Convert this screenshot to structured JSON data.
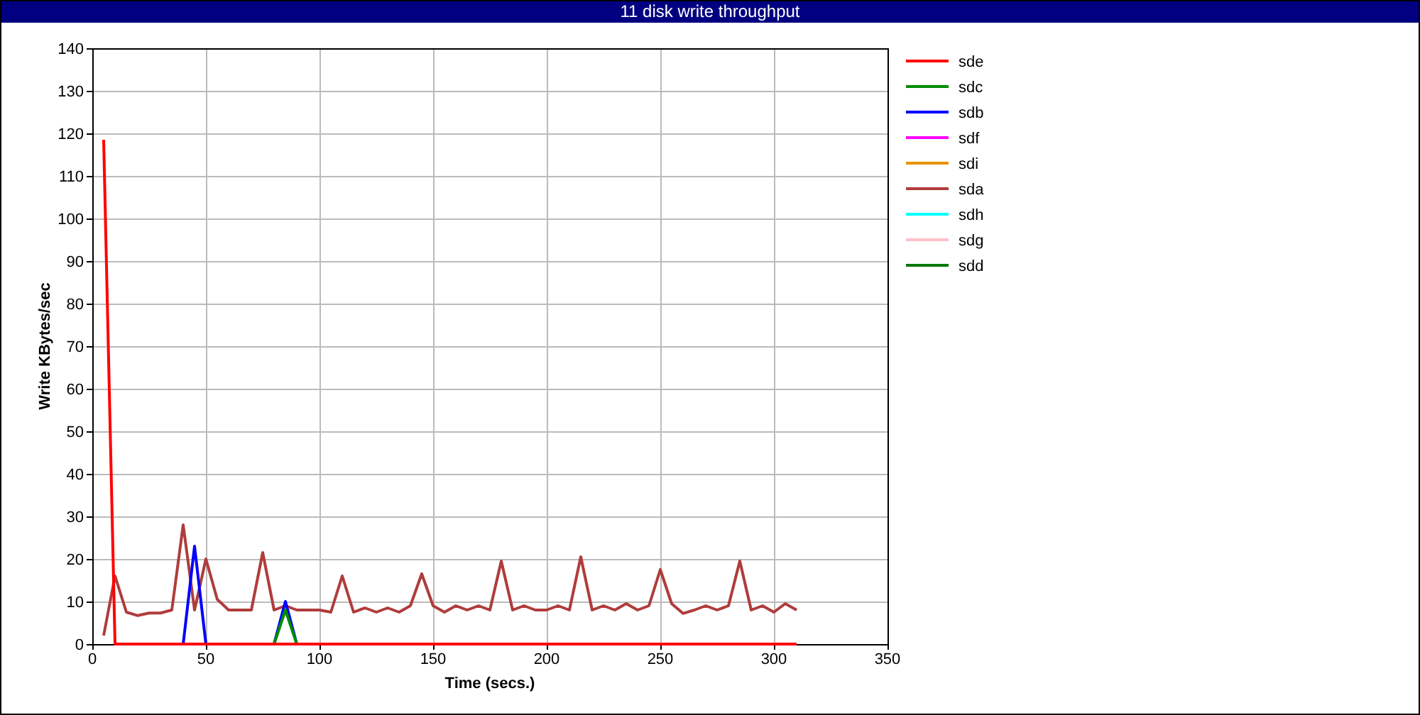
{
  "window": {
    "title": "11 disk write throughput"
  },
  "chart": {
    "chart_data": {
      "type": "line",
      "xlabel": "Time (secs.)",
      "ylabel": "Write KBytes/sec",
      "x": [
        5,
        10,
        15,
        20,
        25,
        30,
        35,
        40,
        45,
        50,
        55,
        60,
        65,
        70,
        75,
        80,
        85,
        90,
        95,
        100,
        105,
        110,
        115,
        120,
        125,
        130,
        135,
        140,
        145,
        150,
        155,
        160,
        165,
        170,
        175,
        180,
        185,
        190,
        195,
        200,
        205,
        210,
        215,
        220,
        225,
        230,
        235,
        240,
        245,
        250,
        255,
        260,
        265,
        270,
        275,
        280,
        285,
        290,
        295,
        300,
        305,
        310
      ],
      "xlim": [
        0,
        350
      ],
      "ylim": [
        0,
        140
      ],
      "xticks": [
        0,
        50,
        100,
        150,
        200,
        250,
        300,
        350
      ],
      "yticks": [
        0,
        10,
        20,
        30,
        40,
        50,
        60,
        70,
        80,
        90,
        100,
        110,
        120,
        130,
        140
      ],
      "series": [
        {
          "name": "sde",
          "color": "#ff0000",
          "values": [
            118.5,
            0,
            0,
            0,
            0,
            0,
            0,
            0,
            0,
            0,
            0,
            0,
            0,
            0,
            0,
            0,
            0,
            0,
            0,
            0,
            0,
            0,
            0,
            0,
            0,
            0,
            0,
            0,
            0,
            0,
            0,
            0,
            0,
            0,
            0,
            0,
            0,
            0,
            0,
            0,
            0,
            0,
            0,
            0,
            0,
            0,
            0,
            0,
            0,
            0,
            0,
            0,
            0,
            0,
            0,
            0,
            0,
            0,
            0,
            0,
            0,
            0
          ]
        },
        {
          "name": "sdc",
          "color": "#008c00",
          "values": [
            null,
            null,
            null,
            null,
            null,
            null,
            null,
            null,
            null,
            null,
            null,
            null,
            null,
            null,
            null,
            0,
            8,
            0,
            null,
            null,
            null,
            null,
            null,
            null,
            null,
            null,
            null,
            null,
            null,
            null,
            null,
            null,
            null,
            null,
            null,
            null,
            null,
            null,
            null,
            null,
            null,
            null,
            null,
            null,
            null,
            null,
            null,
            null,
            null,
            null,
            null,
            null,
            null,
            null,
            null,
            null,
            null,
            null,
            null,
            null,
            null,
            null
          ]
        },
        {
          "name": "sdb",
          "color": "#0000ff",
          "values": [
            null,
            null,
            null,
            null,
            null,
            null,
            null,
            0,
            23,
            0,
            null,
            null,
            null,
            null,
            null,
            0,
            10,
            0,
            null,
            null,
            null,
            null,
            null,
            null,
            null,
            null,
            null,
            null,
            null,
            null,
            null,
            null,
            null,
            null,
            null,
            null,
            null,
            null,
            null,
            null,
            null,
            null,
            null,
            null,
            null,
            null,
            null,
            null,
            null,
            null,
            null,
            null,
            null,
            null,
            null,
            null,
            null,
            null,
            null,
            null,
            null,
            null
          ]
        },
        {
          "name": "sdf",
          "color": "#ff00ff",
          "values": [
            null,
            null,
            null,
            null,
            null,
            null,
            null,
            null,
            null,
            null,
            null,
            null,
            null,
            null,
            null,
            null,
            null,
            null,
            null,
            null,
            null,
            null,
            null,
            null,
            null,
            null,
            null,
            null,
            null,
            null,
            null,
            null,
            null,
            null,
            null,
            null,
            null,
            null,
            null,
            null,
            null,
            null,
            null,
            null,
            null,
            null,
            null,
            null,
            null,
            null,
            null,
            null,
            null,
            null,
            null,
            null,
            null,
            null,
            null,
            null,
            null,
            null
          ]
        },
        {
          "name": "sdi",
          "color": "#e89400",
          "values": [
            null,
            null,
            null,
            null,
            null,
            null,
            null,
            null,
            null,
            null,
            null,
            null,
            null,
            null,
            null,
            null,
            null,
            null,
            null,
            null,
            null,
            null,
            null,
            null,
            null,
            null,
            null,
            null,
            null,
            null,
            null,
            null,
            null,
            null,
            null,
            null,
            null,
            null,
            null,
            null,
            null,
            null,
            null,
            null,
            null,
            null,
            null,
            null,
            null,
            null,
            null,
            null,
            null,
            null,
            null,
            null,
            null,
            null,
            null,
            null,
            null,
            null
          ]
        },
        {
          "name": "sda",
          "color": "#b03c3c",
          "values": [
            2,
            16,
            7.5,
            6.7,
            7.3,
            7.3,
            8,
            28,
            8,
            20,
            10.5,
            8,
            8,
            8,
            21.5,
            8,
            9,
            8,
            8,
            8,
            7.5,
            16,
            7.5,
            8.5,
            7.5,
            8.5,
            7.5,
            9,
            16.5,
            9,
            7.5,
            9,
            8,
            9,
            8,
            19.5,
            8,
            9,
            8,
            8,
            9,
            8,
            20.5,
            8,
            9,
            8,
            9.5,
            8,
            9,
            17.5,
            9.5,
            7.2,
            8,
            9,
            8,
            9,
            19.5,
            8,
            9,
            7.5,
            9.5,
            8
          ]
        },
        {
          "name": "sdh",
          "color": "#00ffff",
          "values": [
            null,
            null,
            null,
            null,
            null,
            null,
            null,
            null,
            null,
            null,
            null,
            null,
            null,
            null,
            null,
            null,
            null,
            null,
            null,
            null,
            null,
            null,
            null,
            null,
            null,
            null,
            null,
            null,
            null,
            null,
            null,
            null,
            null,
            null,
            null,
            null,
            null,
            null,
            null,
            null,
            null,
            null,
            null,
            null,
            null,
            null,
            null,
            null,
            null,
            null,
            null,
            null,
            null,
            null,
            null,
            null,
            null,
            null,
            null,
            null,
            null,
            null
          ]
        },
        {
          "name": "sdg",
          "color": "#ffc0cb",
          "values": [
            null,
            null,
            null,
            null,
            null,
            null,
            null,
            null,
            null,
            null,
            null,
            null,
            null,
            null,
            null,
            null,
            null,
            null,
            null,
            null,
            null,
            null,
            null,
            null,
            null,
            null,
            null,
            null,
            null,
            null,
            null,
            null,
            null,
            null,
            null,
            null,
            null,
            null,
            null,
            null,
            null,
            null,
            null,
            null,
            null,
            null,
            null,
            null,
            null,
            null,
            null,
            null,
            null,
            null,
            null,
            null,
            null,
            null,
            null,
            null,
            null,
            null
          ]
        },
        {
          "name": "sdd",
          "color": "#007800",
          "values": [
            null,
            null,
            null,
            null,
            null,
            null,
            null,
            null,
            null,
            null,
            null,
            null,
            null,
            null,
            null,
            null,
            null,
            null,
            null,
            null,
            null,
            null,
            null,
            null,
            null,
            null,
            null,
            null,
            null,
            null,
            null,
            null,
            null,
            null,
            null,
            null,
            null,
            null,
            null,
            null,
            null,
            null,
            null,
            null,
            null,
            null,
            null,
            null,
            null,
            null,
            null,
            null,
            null,
            null,
            null,
            null,
            null,
            null,
            null,
            null,
            null,
            null
          ]
        }
      ],
      "grid": true,
      "legend": true
    }
  }
}
